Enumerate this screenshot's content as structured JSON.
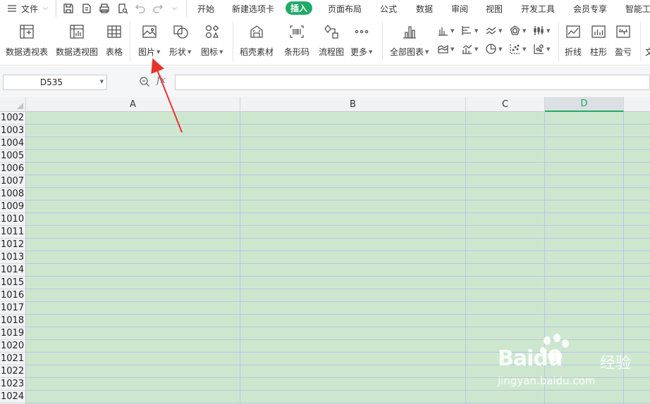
{
  "menu": {
    "hamburger_icon": "hamburger-icon",
    "file_label": "文件",
    "tabs": [
      {
        "label": "开始"
      },
      {
        "label": "新建选项卡"
      },
      {
        "label": "插入",
        "active": true
      },
      {
        "label": "页面布局"
      },
      {
        "label": "公式"
      },
      {
        "label": "数据"
      },
      {
        "label": "审阅"
      },
      {
        "label": "视图"
      },
      {
        "label": "开发工具"
      },
      {
        "label": "会员专享"
      },
      {
        "label": "智能工"
      }
    ],
    "active_color": "#1faa68"
  },
  "ribbon": {
    "pivot_table": "数据透视表",
    "pivot_chart": "数据透视图",
    "table": "表格",
    "picture": "图片",
    "shape": "形状",
    "icon": "图标",
    "docer_material": "稻壳素材",
    "barcode": "条形码",
    "flowchart": "流程图",
    "more": "更多",
    "all_charts": "全部图表",
    "line": "折线",
    "column": "柱形",
    "win_loss": "盈亏",
    "text_cut": "文"
  },
  "formula_bar": {
    "cell_ref": "D535",
    "fx": "fx",
    "value": ""
  },
  "sheet": {
    "columns": [
      {
        "label": "A",
        "selected": false
      },
      {
        "label": "B",
        "selected": false
      },
      {
        "label": "C",
        "selected": false
      },
      {
        "label": "D",
        "selected": true
      }
    ],
    "rows": [
      "1002",
      "1003",
      "1004",
      "1005",
      "1006",
      "1007",
      "1008",
      "1009",
      "1010",
      "1011",
      "1012",
      "1013",
      "1014",
      "1015",
      "1016",
      "1017",
      "1018",
      "1019",
      "1020",
      "1021",
      "1022",
      "1023",
      "1024"
    ],
    "cell_fill_color": "#cde7cf",
    "grid_line_color": "#b9c4e6",
    "selected_header_color": "#1faa68"
  },
  "annotation": {
    "arrow_color": "#e8322b"
  },
  "watermark": {
    "brand": "Baidu",
    "text": "经验",
    "url": "jingyan.baidu.com"
  }
}
